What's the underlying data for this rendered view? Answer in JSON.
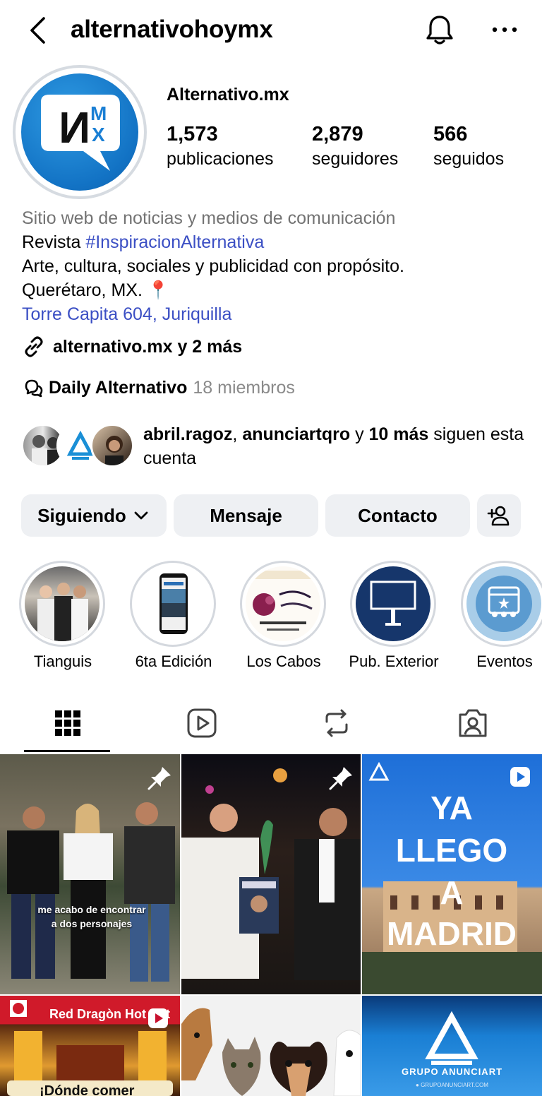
{
  "header": {
    "username": "alternativohoymx"
  },
  "profile": {
    "full_name": "Alternativo.mx",
    "avatar_logo": "МX",
    "stats": [
      {
        "value": "1,573",
        "label": "publicaciones"
      },
      {
        "value": "2,879",
        "label": "seguidores"
      },
      {
        "value": "566",
        "label": "seguidos"
      }
    ]
  },
  "bio": {
    "category": "Sitio web de noticias y medios de comunicación",
    "line1_prefix": "Revista ",
    "line1_hashtag": "#InspiracionAlternativa",
    "line2": "Arte, cultura, sociales y publicidad con propósito.",
    "line3": "Querétaro, MX. 📍",
    "address": "Torre Capita 604, Juriquilla",
    "link": "alternativo.mx y 2 más",
    "channel_name": "Daily Alternativo",
    "channel_members": "18 miembros"
  },
  "followed_by": {
    "user1": "abril.ragoz",
    "separator": ", ",
    "user2": "anunciartqro",
    "connector": " y ",
    "others": "10 más",
    "suffix": " siguen esta cuenta"
  },
  "buttons": {
    "following": "Siguiendo",
    "message": "Mensaje",
    "contact": "Contacto"
  },
  "highlights": [
    {
      "label": "Tianguis"
    },
    {
      "label": "6ta Edición"
    },
    {
      "label": "Los Cabos"
    },
    {
      "label": "Pub. Exterior"
    },
    {
      "label": "Eventos"
    }
  ],
  "grid": {
    "post1_caption": "me acabo de encontrar a dos personajes",
    "post3_text": "YA LLEGO A MADRID",
    "post4_text": "Red Dragòn Hot Pot",
    "post4_bottom": "¡Dónde comer",
    "post6_text": "GRUPO ANUNCIART",
    "post6_url": "● GRUPOANUNCIART.COM"
  },
  "colors": {
    "link_blue": "#3b4fc4",
    "button_bg": "#eef0f3",
    "avatar_blue": "#1a7fd4"
  }
}
